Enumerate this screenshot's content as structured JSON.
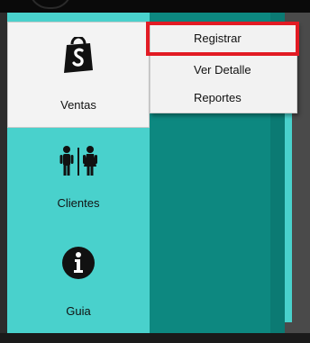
{
  "sidebar": {
    "items": [
      {
        "label": "Ventas",
        "icon": "shopping-bag-icon"
      },
      {
        "label": "Clientes",
        "icon": "restroom-people-icon"
      },
      {
        "label": "Guia",
        "icon": "info-icon"
      }
    ]
  },
  "dropdown": {
    "items": [
      {
        "label": "Registrar"
      },
      {
        "label": "Ver Detalle"
      },
      {
        "label": "Reportes"
      }
    ]
  },
  "colors": {
    "sidebar_bg": "#49d1cc",
    "main_bg": "#0d8880",
    "highlight": "#e21b24"
  }
}
